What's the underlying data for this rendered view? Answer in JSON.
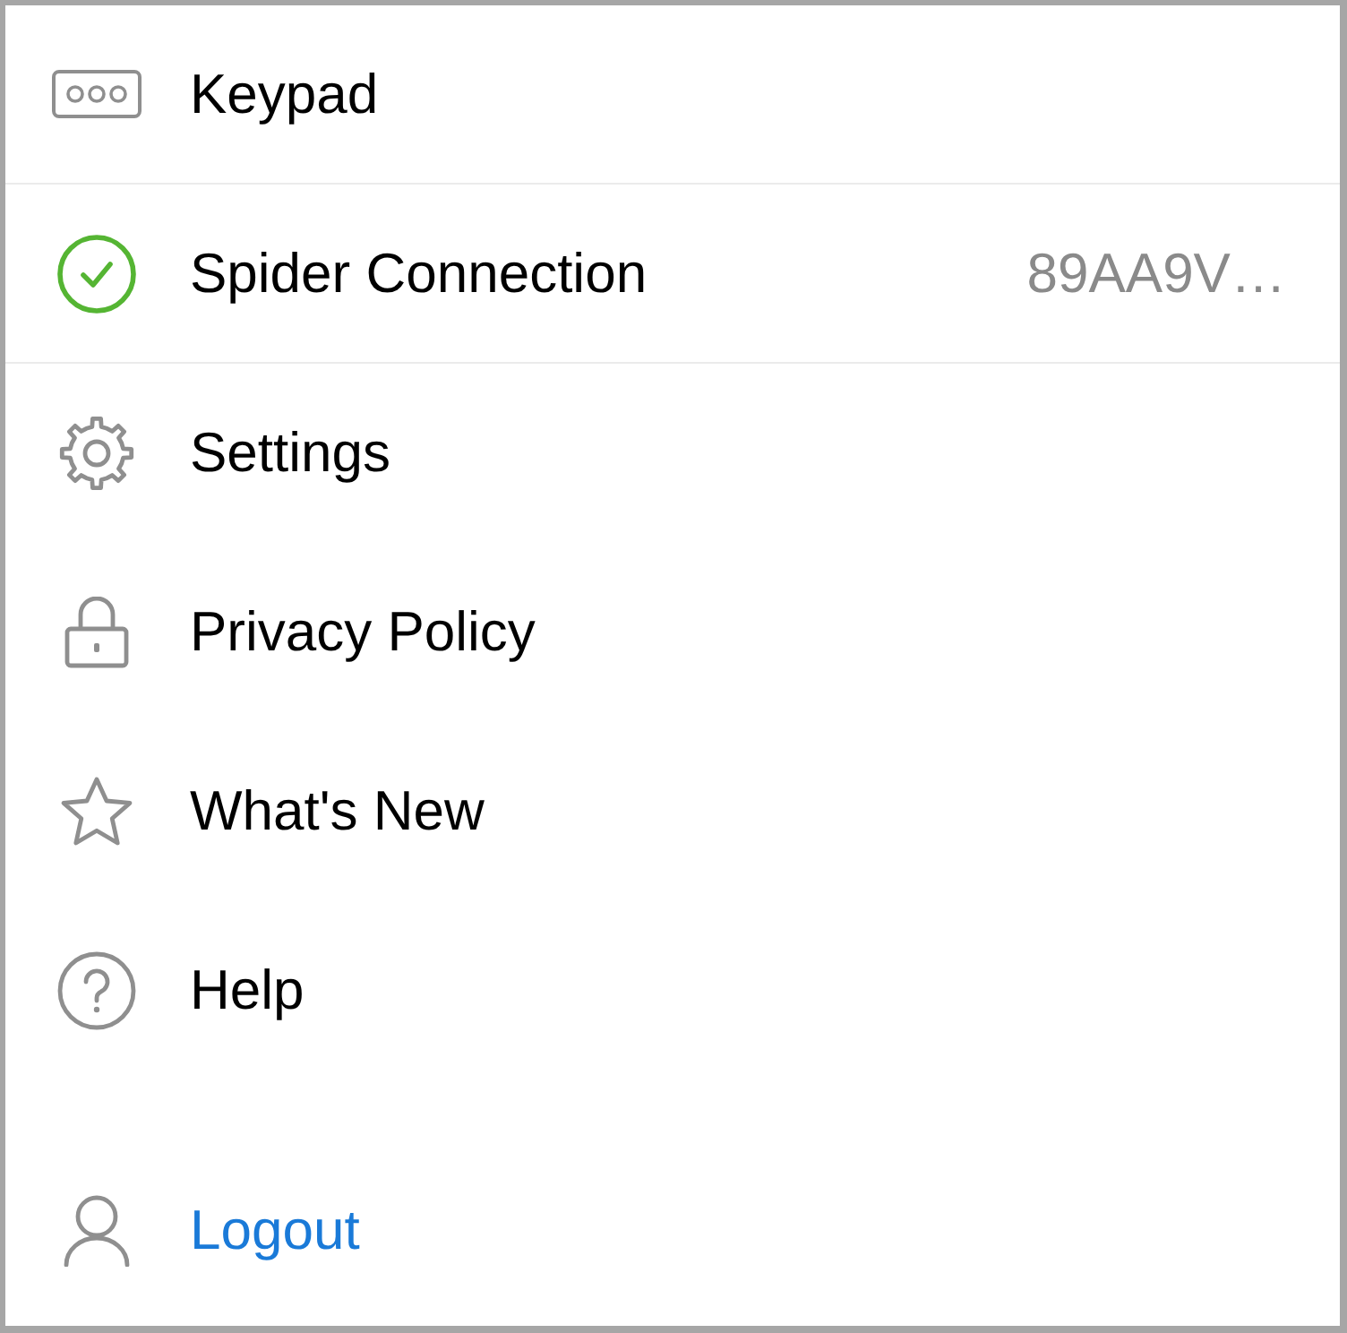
{
  "menu": {
    "top_items": [
      {
        "label": "Keypad"
      },
      {
        "label": "Spider Connection",
        "value": "89AA9V…",
        "connected": true
      }
    ],
    "items": [
      {
        "label": "Settings"
      },
      {
        "label": "Privacy Policy"
      },
      {
        "label": "What's New"
      },
      {
        "label": "Help"
      }
    ]
  },
  "logout": {
    "label": "Logout"
  }
}
